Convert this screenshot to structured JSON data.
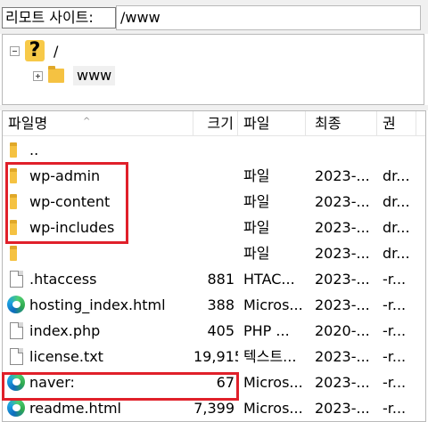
{
  "path_bar": {
    "label": "리모트 사이트:",
    "value": "/www"
  },
  "tree": {
    "root_label": "/",
    "child_label": "www",
    "root_icon": "question-folder-icon",
    "child_icon": "folder-icon"
  },
  "columns": [
    {
      "label": "파일명"
    },
    {
      "label": "크기"
    },
    {
      "label": "파일"
    },
    {
      "label": "최종"
    },
    {
      "label": "권"
    }
  ],
  "files": [
    {
      "name": "..",
      "size": "",
      "type": "",
      "date": "",
      "perm": "",
      "icon": "folder-icon"
    },
    {
      "name": "wp-admin",
      "size": "",
      "type": "파일",
      "date": "2023-...",
      "perm": "dr...",
      "icon": "folder-icon"
    },
    {
      "name": "wp-content",
      "size": "",
      "type": "파일",
      "date": "2023-...",
      "perm": "dr...",
      "icon": "folder-icon"
    },
    {
      "name": "wp-includes",
      "size": "",
      "type": "파일",
      "date": "2023-...",
      "perm": "dr...",
      "icon": "folder-icon"
    },
    {
      "name": "",
      "size": "",
      "type": "파일",
      "date": "2023-...",
      "perm": "dr...",
      "icon": "folder-icon"
    },
    {
      "name": ".htaccess",
      "size": "881",
      "type": "HTAC...",
      "date": "2023-...",
      "perm": "-r...",
      "icon": "file-icon"
    },
    {
      "name": "hosting_index.html",
      "size": "388",
      "type": "Micros...",
      "date": "2023-...",
      "perm": "-r...",
      "icon": "edge-icon"
    },
    {
      "name": "index.php",
      "size": "405",
      "type": "PHP ...",
      "date": "2020-...",
      "perm": "-r...",
      "icon": "file-icon"
    },
    {
      "name": "license.txt",
      "size": "19,915",
      "type": "텍스트...",
      "date": "2023-...",
      "perm": "-r...",
      "icon": "file-icon"
    },
    {
      "name": "naver:",
      "size": "67",
      "type": "Micros...",
      "date": "2023-...",
      "perm": "-r...",
      "icon": "edge-icon"
    },
    {
      "name": "readme.html",
      "size": "7,399",
      "type": "Micros...",
      "date": "2023-...",
      "perm": "-r...",
      "icon": "edge-icon"
    }
  ],
  "highlight_color": "#e0202a"
}
